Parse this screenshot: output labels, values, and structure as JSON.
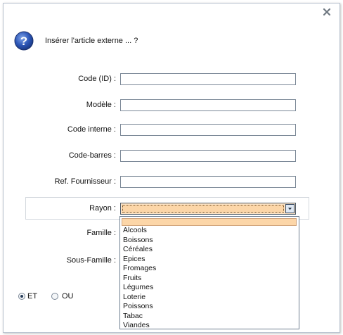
{
  "dialog": {
    "question": "Insérer l'article externe ... ?",
    "close_icon": "close-icon",
    "question_icon": "question-icon"
  },
  "form": {
    "code_id_label": "Code (ID) :",
    "modele_label": "Modèle :",
    "code_interne_label": "Code interne :",
    "code_barres_label": "Code-barres :",
    "ref_fournisseur_label": "Ref. Fournisseur :",
    "rayon_label": "Rayon :",
    "famille_label": "Famille :",
    "sous_famille_label": "Sous-Famille :",
    "code_id_value": "",
    "modele_value": "",
    "code_interne_value": "",
    "code_barres_value": "",
    "ref_fournisseur_value": "",
    "rayon_value": ""
  },
  "rayon_options": [
    "",
    "Alcools",
    "Boissons",
    "Céréales",
    "Epices",
    "Fromages",
    "Fruits",
    "Légumes",
    "Loterie",
    "Poissons",
    "Tabac",
    "Viandes"
  ],
  "radio": {
    "et_label": "ET",
    "ou_label": "OU",
    "selected": "ET"
  },
  "colors": {
    "highlight": "#fcd6a8",
    "border": "#7a8796",
    "icon_blue": "#2a4fa8"
  }
}
